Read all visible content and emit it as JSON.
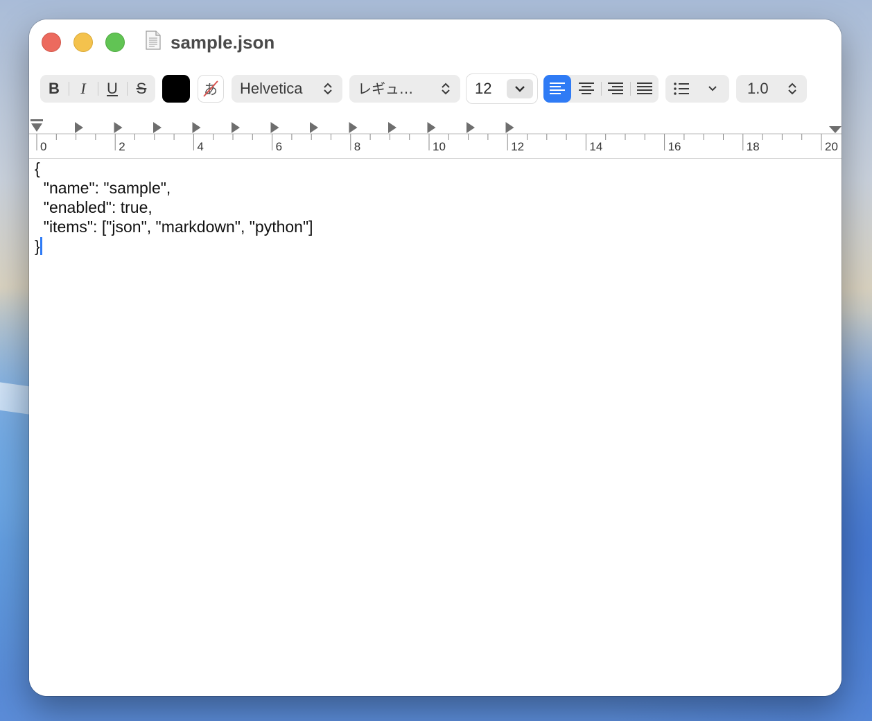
{
  "window": {
    "title": "sample.json"
  },
  "toolbar": {
    "bold_label": "B",
    "italic_label": "I",
    "underline_label": "U",
    "strikethrough_label": "S",
    "text_color": "#000000",
    "font_family": "Helvetica",
    "font_style": "レギュ…",
    "font_size": "12",
    "alignment_selected": "left",
    "line_spacing": "1.0",
    "accent_color": "#2f7bf5"
  },
  "ruler": {
    "labels": [
      "0",
      "2",
      "4",
      "6",
      "8",
      "10",
      "12",
      "14",
      "16",
      "18",
      "20"
    ]
  },
  "document": {
    "lines": [
      "{",
      "  \"name\": \"sample\",",
      "  \"enabled\": true,",
      "  \"items\": [\"json\", \"markdown\", \"python\"]",
      "}"
    ]
  }
}
